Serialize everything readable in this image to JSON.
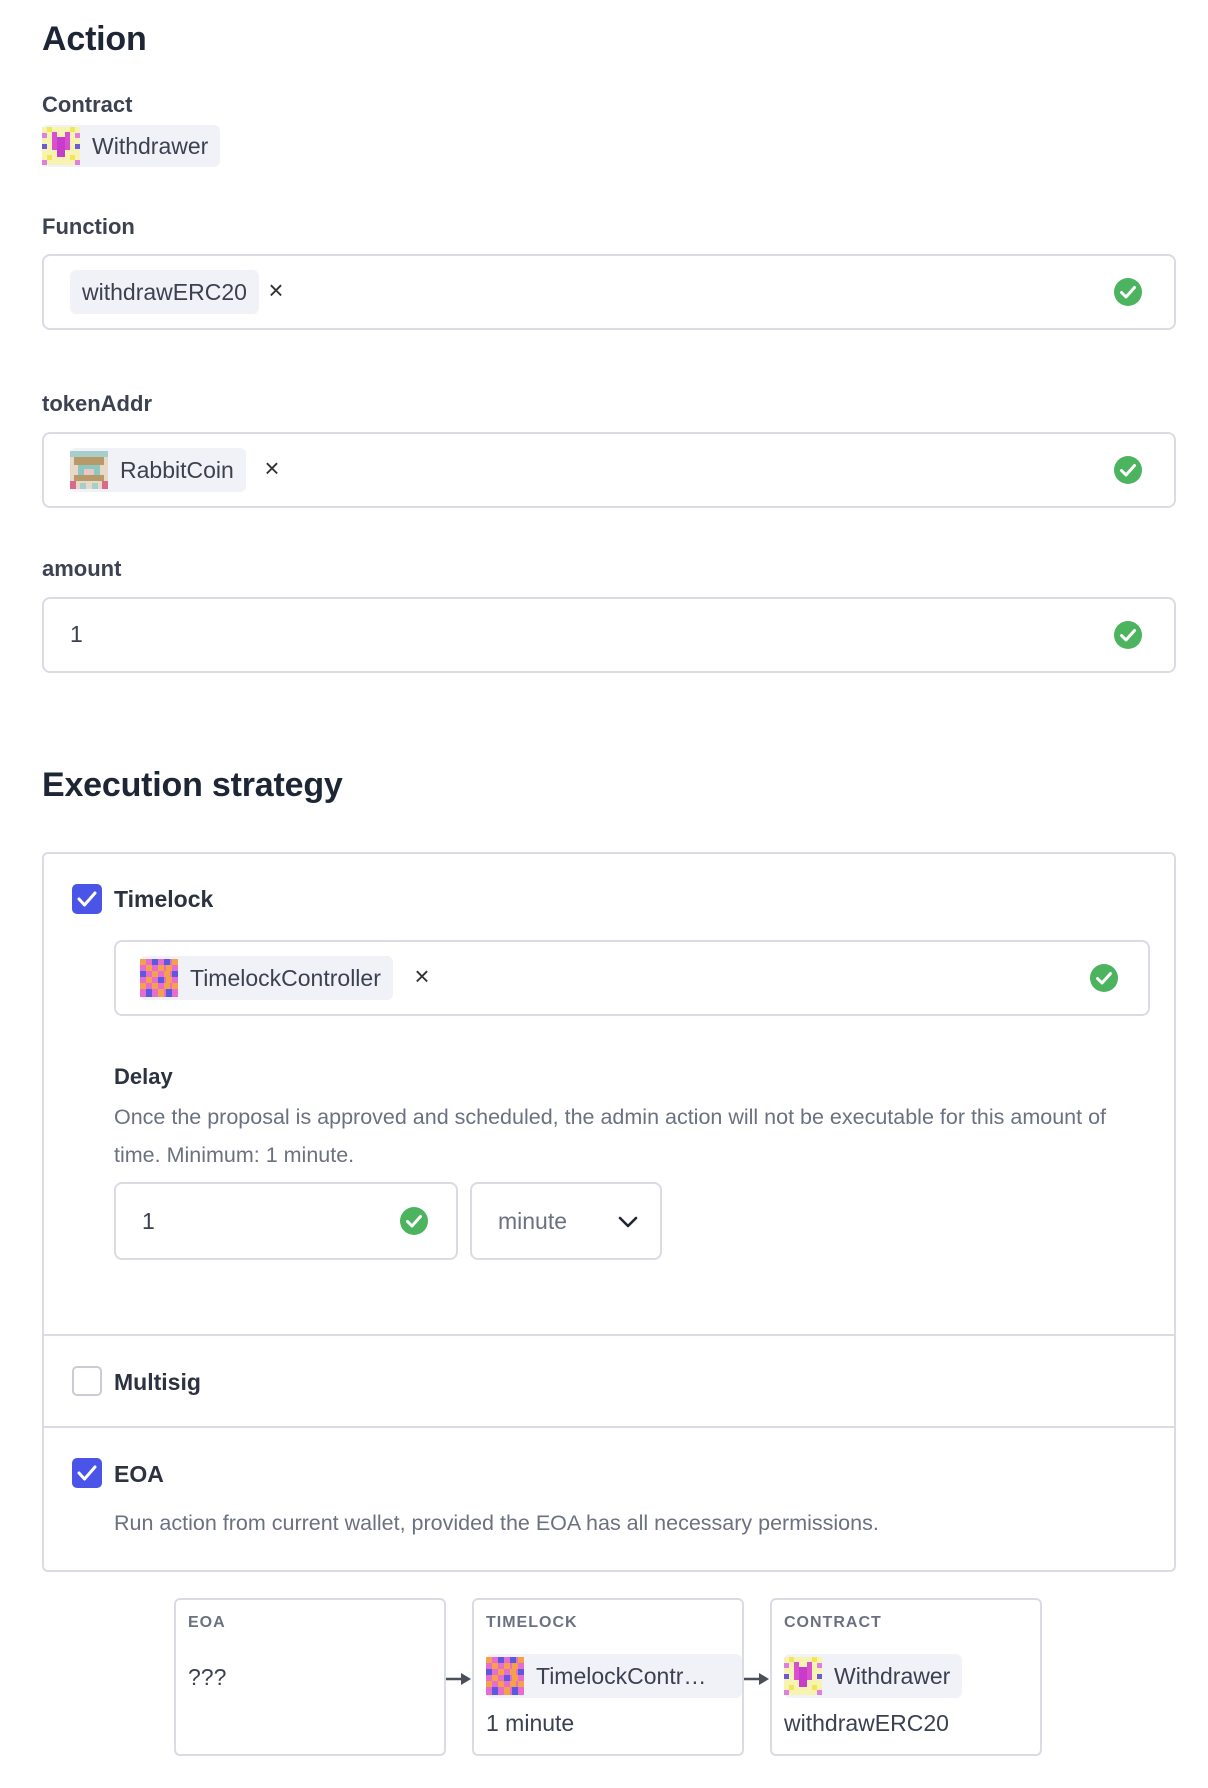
{
  "action": {
    "title": "Action",
    "contract_label": "Contract",
    "contract_name": "Withdrawer",
    "function_label": "Function",
    "function_value": "withdrawERC20",
    "token_label": "tokenAddr",
    "token_value": "RabbitCoin",
    "amount_label": "amount",
    "amount_value": "1"
  },
  "execution": {
    "title": "Execution strategy",
    "timelock": {
      "label": "Timelock",
      "checked": true,
      "controller": "TimelockController",
      "delay_label": "Delay",
      "delay_description": "Once the proposal is approved and scheduled, the admin action will not be executable for this amount of time. Minimum: 1 minute.",
      "delay_value": "1",
      "delay_unit": "minute"
    },
    "multisig": {
      "label": "Multisig",
      "checked": false
    },
    "eoa": {
      "label": "EOA",
      "checked": true,
      "description": "Run action from current wallet, provided the EOA has all necessary permissions."
    }
  },
  "flow": {
    "eoa": {
      "title": "EOA",
      "value": "???"
    },
    "timelock": {
      "title": "TIMELOCK",
      "name": "TimelockContr…",
      "sub": "1 minute"
    },
    "contract": {
      "title": "CONTRACT",
      "name": "Withdrawer",
      "sub": "withdrawERC20"
    }
  },
  "colors": {
    "accent": "#4a55e8",
    "success": "#4cb35e",
    "border": "#d9dce3"
  },
  "icons": [
    "contract-avatar-icon",
    "close-icon",
    "check-circle-icon",
    "chevron-down-icon",
    "arrow-right-icon"
  ]
}
